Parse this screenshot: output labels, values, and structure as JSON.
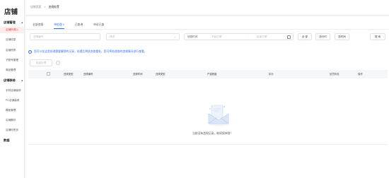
{
  "brand": {
    "logo": "店铺"
  },
  "sidebar": {
    "sections": [
      {
        "label": "店铺管理",
        "chevron": "▲"
      },
      {
        "label": "店铺装修",
        "chevron": "▲"
      },
      {
        "label": "数据",
        "chevron": ""
      }
    ],
    "items": [
      {
        "label": "店铺申请入",
        "active": true
      },
      {
        "label": "店铺信息"
      },
      {
        "label": "店铺资质"
      },
      {
        "label": "子账号管理"
      },
      {
        "label": "商品管理"
      },
      {
        "label": "手机店铺装修"
      },
      {
        "label": "PC店铺装修"
      },
      {
        "label": "模板管理"
      },
      {
        "label": "店铺素材"
      },
      {
        "label": "店铺标签页"
      }
    ]
  },
  "topbar": {
    "breadcrumb": [
      "店铺页面",
      "违规处置"
    ],
    "separator": ">"
  },
  "tabs": [
    {
      "label": "全部违规",
      "active": false
    },
    {
      "label": "待处理 0",
      "active": true
    },
    {
      "label": "已查询",
      "active": false
    },
    {
      "label": "申诉已查",
      "active": false
    }
  ],
  "filters": {
    "id_placeholder": "违规编号",
    "type_placeholder": "请选",
    "time_label": "违规时间",
    "start_placeholder": "开始日期",
    "range_sep": "-",
    "end_placeholder": "结束日期",
    "dropdown_arrow": "⌄",
    "btn_all": "全 部",
    "btn_export": "违行时",
    "btn_record": "违时间",
    "btn_search": "搜 索"
  },
  "notice": {
    "icon": "i",
    "text": "您可以在这里处理需要解除的记录，处理后将状态查看处，您可将处理各的违规情况进行查看。"
  },
  "batch": {
    "label": "批量处理"
  },
  "table": {
    "columns": [
      "违规类型",
      "违规编号",
      "违规时间",
      "违规类型",
      "严重程度",
      "扣分",
      "处罚状态",
      "操作"
    ],
    "rows": []
  },
  "empty": {
    "text": "当前没有违规记录，继续保持哦！"
  },
  "colors": {
    "accent": "#2f6df6",
    "active_nav": "#e23d3d"
  }
}
